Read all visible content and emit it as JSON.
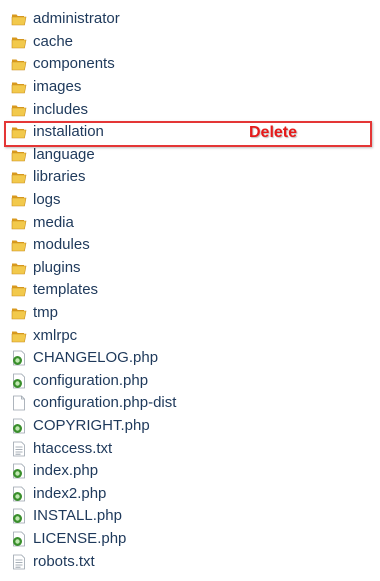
{
  "items": [
    {
      "label": "administrator",
      "type": "folder"
    },
    {
      "label": "cache",
      "type": "folder"
    },
    {
      "label": "components",
      "type": "folder"
    },
    {
      "label": "images",
      "type": "folder"
    },
    {
      "label": "includes",
      "type": "folder"
    },
    {
      "label": "installation",
      "type": "folder"
    },
    {
      "label": "language",
      "type": "folder"
    },
    {
      "label": "libraries",
      "type": "folder"
    },
    {
      "label": "logs",
      "type": "folder"
    },
    {
      "label": "media",
      "type": "folder"
    },
    {
      "label": "modules",
      "type": "folder"
    },
    {
      "label": "plugins",
      "type": "folder"
    },
    {
      "label": "templates",
      "type": "folder"
    },
    {
      "label": "tmp",
      "type": "folder"
    },
    {
      "label": "xmlrpc",
      "type": "folder"
    },
    {
      "label": "CHANGELOG.php",
      "type": "php"
    },
    {
      "label": "configuration.php",
      "type": "php"
    },
    {
      "label": "configuration.php-dist",
      "type": "file"
    },
    {
      "label": "COPYRIGHT.php",
      "type": "php"
    },
    {
      "label": "htaccess.txt",
      "type": "txt"
    },
    {
      "label": "index.php",
      "type": "php"
    },
    {
      "label": "index2.php",
      "type": "php"
    },
    {
      "label": "INSTALL.php",
      "type": "php"
    },
    {
      "label": "LICENSE.php",
      "type": "php"
    },
    {
      "label": "robots.txt",
      "type": "txt"
    }
  ],
  "annotation": {
    "label": "Delete",
    "target": "installation",
    "color": "#e61b1b"
  },
  "colors": {
    "text": "#1e395b",
    "folder": "#e8b83c",
    "highlight_border": "#e43636"
  }
}
